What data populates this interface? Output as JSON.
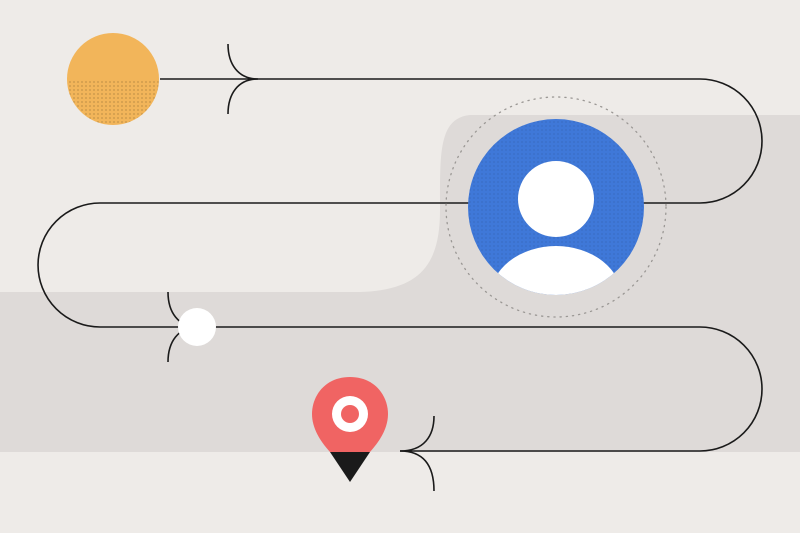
{
  "colors": {
    "background": "#eeebe8",
    "band": "#dedad8",
    "sun": "#f2b55a",
    "avatar_circle": "#3f78d8",
    "avatar_figure": "#ffffff",
    "small_dot": "#ffffff",
    "pin": "#f06463",
    "pin_tip": "#1a1a1a",
    "path_line": "#1a1a1a",
    "dotted_ring": "#9a9794"
  },
  "icons": {
    "start": "sun-circle-icon",
    "user": "user-avatar-icon",
    "waypoint": "waypoint-dot-icon",
    "destination": "location-pin-icon",
    "arrows": "chevron-arrow-icon"
  }
}
